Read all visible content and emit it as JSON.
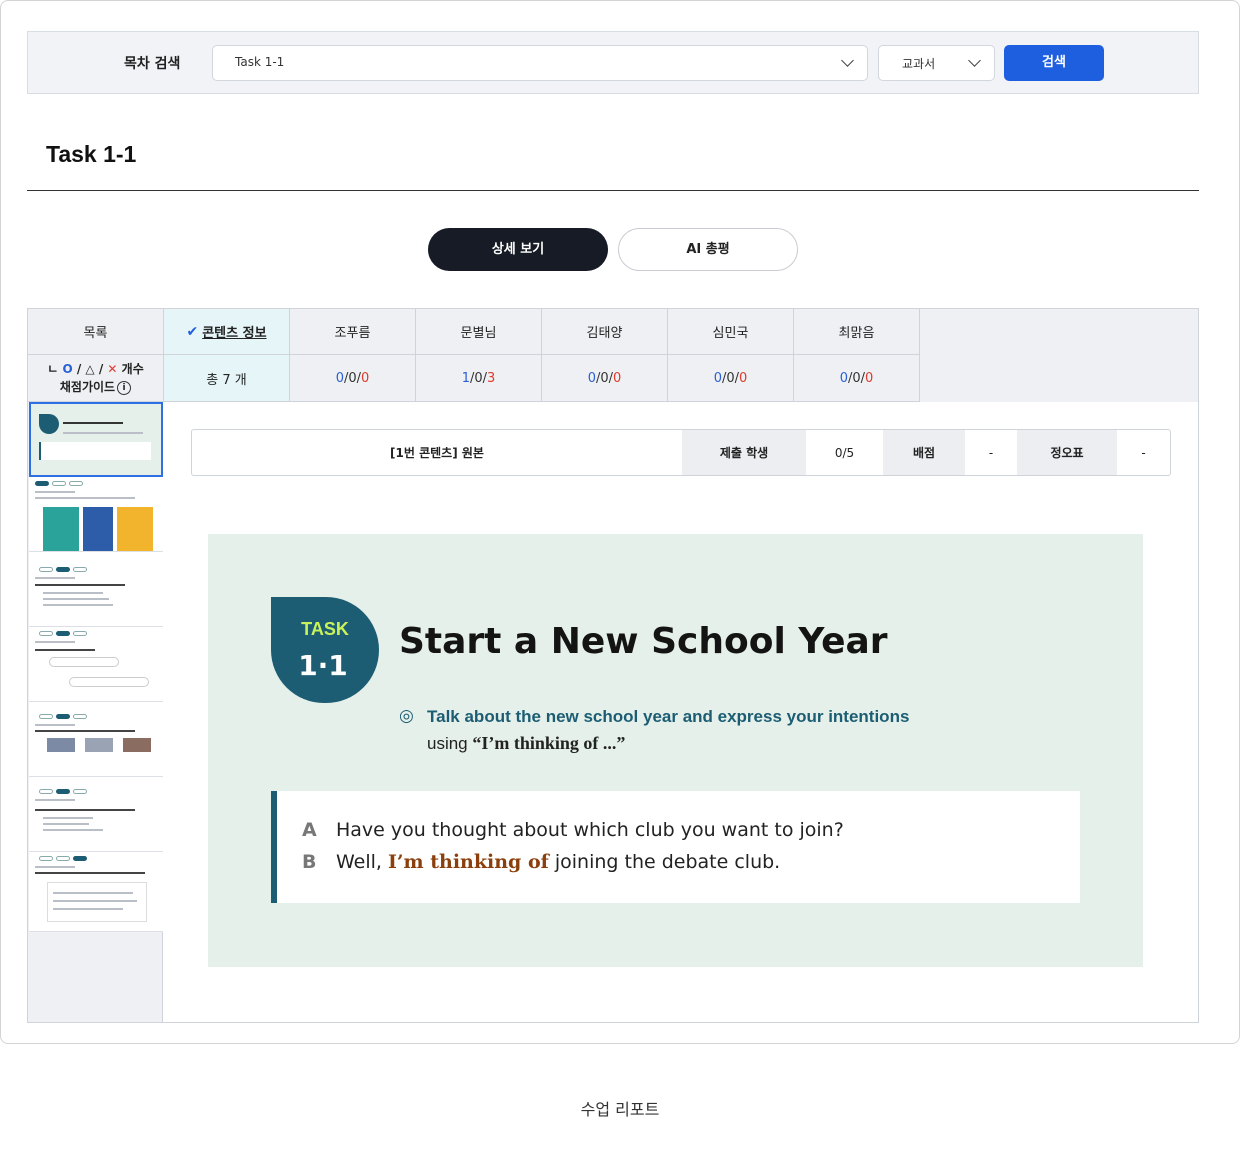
{
  "search": {
    "label": "목차 검색",
    "selected": "Task 1-1",
    "book_filter": "교과서",
    "button": "검색"
  },
  "page_title": "Task 1-1",
  "tabs": [
    {
      "label": "상세 보기",
      "active": true
    },
    {
      "label": "AI 총평",
      "active": false
    }
  ],
  "table": {
    "col_list": "목록",
    "col_content": "콘텐츠 정보",
    "students": [
      {
        "name": "조푸름",
        "o": "0",
        "tri": "0",
        "x": "0"
      },
      {
        "name": "문별님",
        "o": "1",
        "tri": "0",
        "x": "3"
      },
      {
        "name": "김태양",
        "o": "0",
        "tri": "0",
        "x": "0"
      },
      {
        "name": "심민국",
        "o": "0",
        "tri": "0",
        "x": "0"
      },
      {
        "name": "최맑음",
        "o": "0",
        "tri": "0",
        "x": "0"
      }
    ],
    "mark_legend_prefix": "ㄴ",
    "mark_o": "O",
    "mark_tri": "△",
    "mark_x": "✕",
    "mark_legend_suffix": "개수",
    "grading_guide": "채점가이드",
    "total": "총 7 개"
  },
  "info_bar": {
    "content_label": "[1번 콘텐츠] 원본",
    "submitted_label": "제출 학생",
    "submitted_value": "0/5",
    "points_label": "배점",
    "points_value": "-",
    "answer_label": "정오표",
    "answer_value": "-"
  },
  "preview": {
    "badge_top": "TASK",
    "badge_bottom": "1·1",
    "title": "Start a New School Year",
    "goal_line1": "Talk about the new school year and express your intentions",
    "goal_using": "using",
    "goal_phrase": "“I’m thinking of ...”",
    "dialog_a_speaker": "A",
    "dialog_a": "Have you thought about which club you want to join?",
    "dialog_b_speaker": "B",
    "dialog_b_pre": "Well,",
    "dialog_b_highlight": "I’m thinking of",
    "dialog_b_post": "joining the debate club."
  },
  "colors": {
    "primary_button": "#1e5fe0",
    "dark_tab": "#161b25",
    "teal": "#1c5d73",
    "correct": "#2a5fd6",
    "wrong": "#e03b2b"
  },
  "caption": "수업 리포트"
}
